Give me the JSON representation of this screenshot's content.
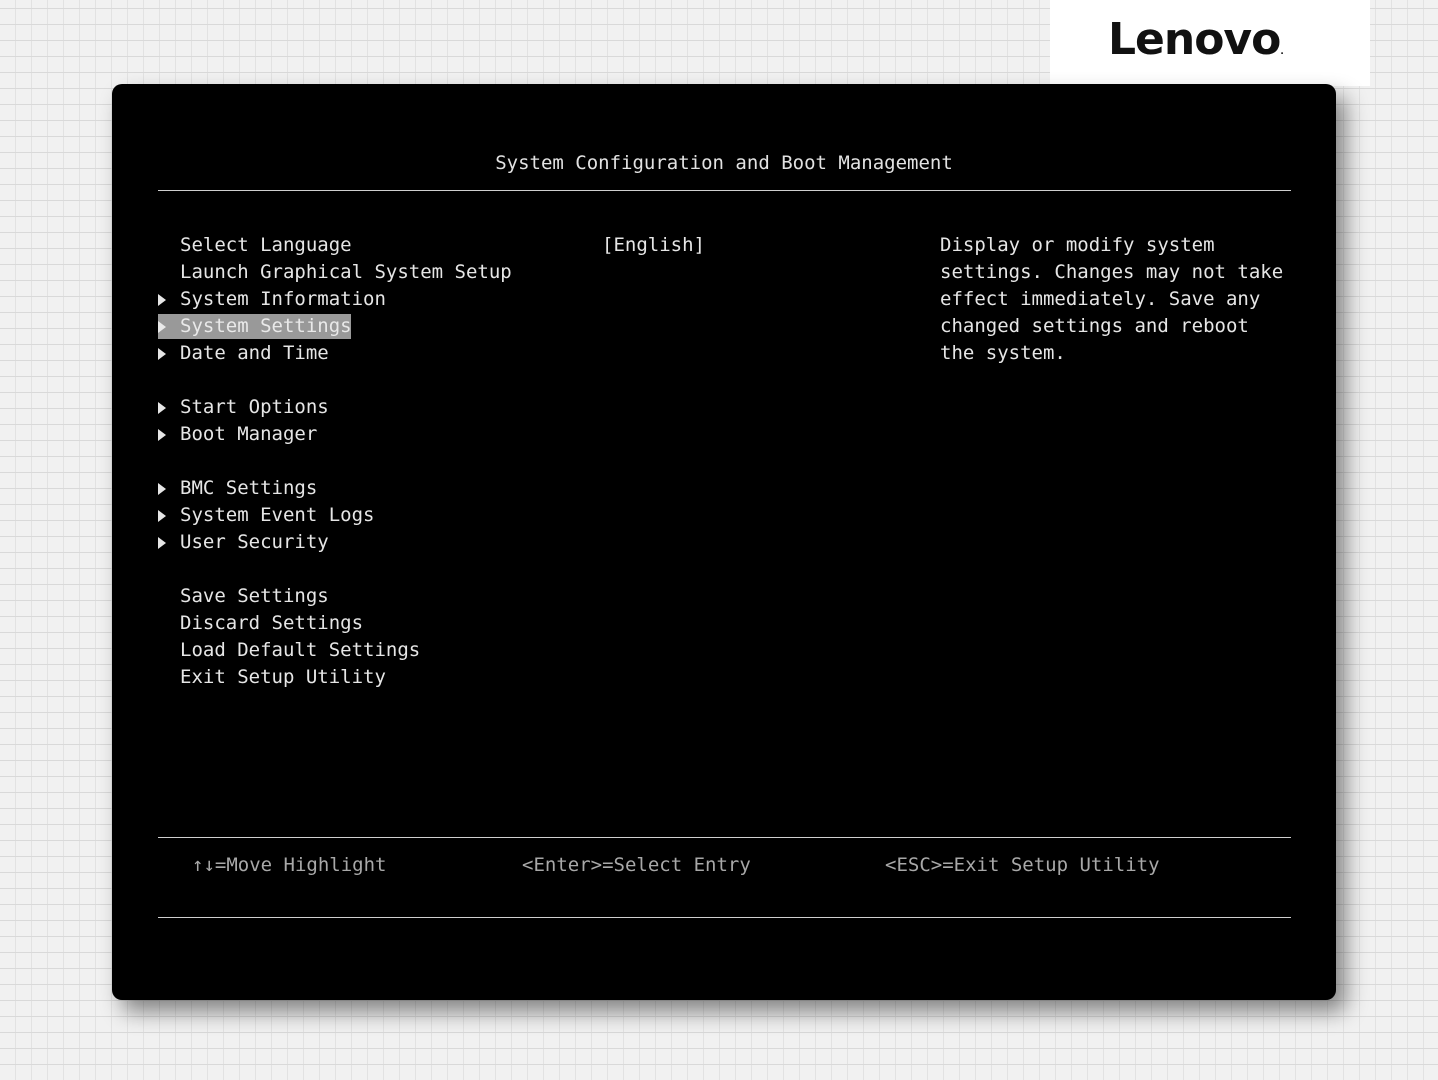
{
  "brand": {
    "logo_text": "Lenovo",
    "trademark": "."
  },
  "header": {
    "title": "System Configuration and Boot Management"
  },
  "menu": {
    "selected": "System Settings",
    "items": [
      {
        "label": "Select Language",
        "submenu": false
      },
      {
        "label": "Launch Graphical System Setup",
        "submenu": false
      },
      {
        "label": "System Information",
        "submenu": true
      },
      {
        "label": "System Settings",
        "submenu": true
      },
      {
        "label": "Date and Time",
        "submenu": true
      },
      {
        "label": "Start Options",
        "submenu": true
      },
      {
        "label": "Boot Manager",
        "submenu": true
      },
      {
        "label": "BMC Settings",
        "submenu": true
      },
      {
        "label": "System Event Logs",
        "submenu": true
      },
      {
        "label": "User Security",
        "submenu": true
      },
      {
        "label": "Save Settings",
        "submenu": false
      },
      {
        "label": "Discard Settings",
        "submenu": false
      },
      {
        "label": "Load Default Settings",
        "submenu": false
      },
      {
        "label": "Exit Setup Utility",
        "submenu": false
      }
    ]
  },
  "language": {
    "value": "[English]"
  },
  "help": {
    "lines": [
      "Display or modify system",
      "settings. Changes may not take",
      "effect immediately. Save any",
      "changed settings and reboot",
      "the system."
    ]
  },
  "footer": {
    "move": "↑↓=Move Highlight",
    "enter": "<Enter>=Select Entry",
    "esc": "<ESC>=Exit Setup Utility"
  },
  "colors": {
    "screen_bg": "#000000",
    "text": "#e6e6e6",
    "highlight": "#999999",
    "footer_text": "#a8a8a8"
  }
}
